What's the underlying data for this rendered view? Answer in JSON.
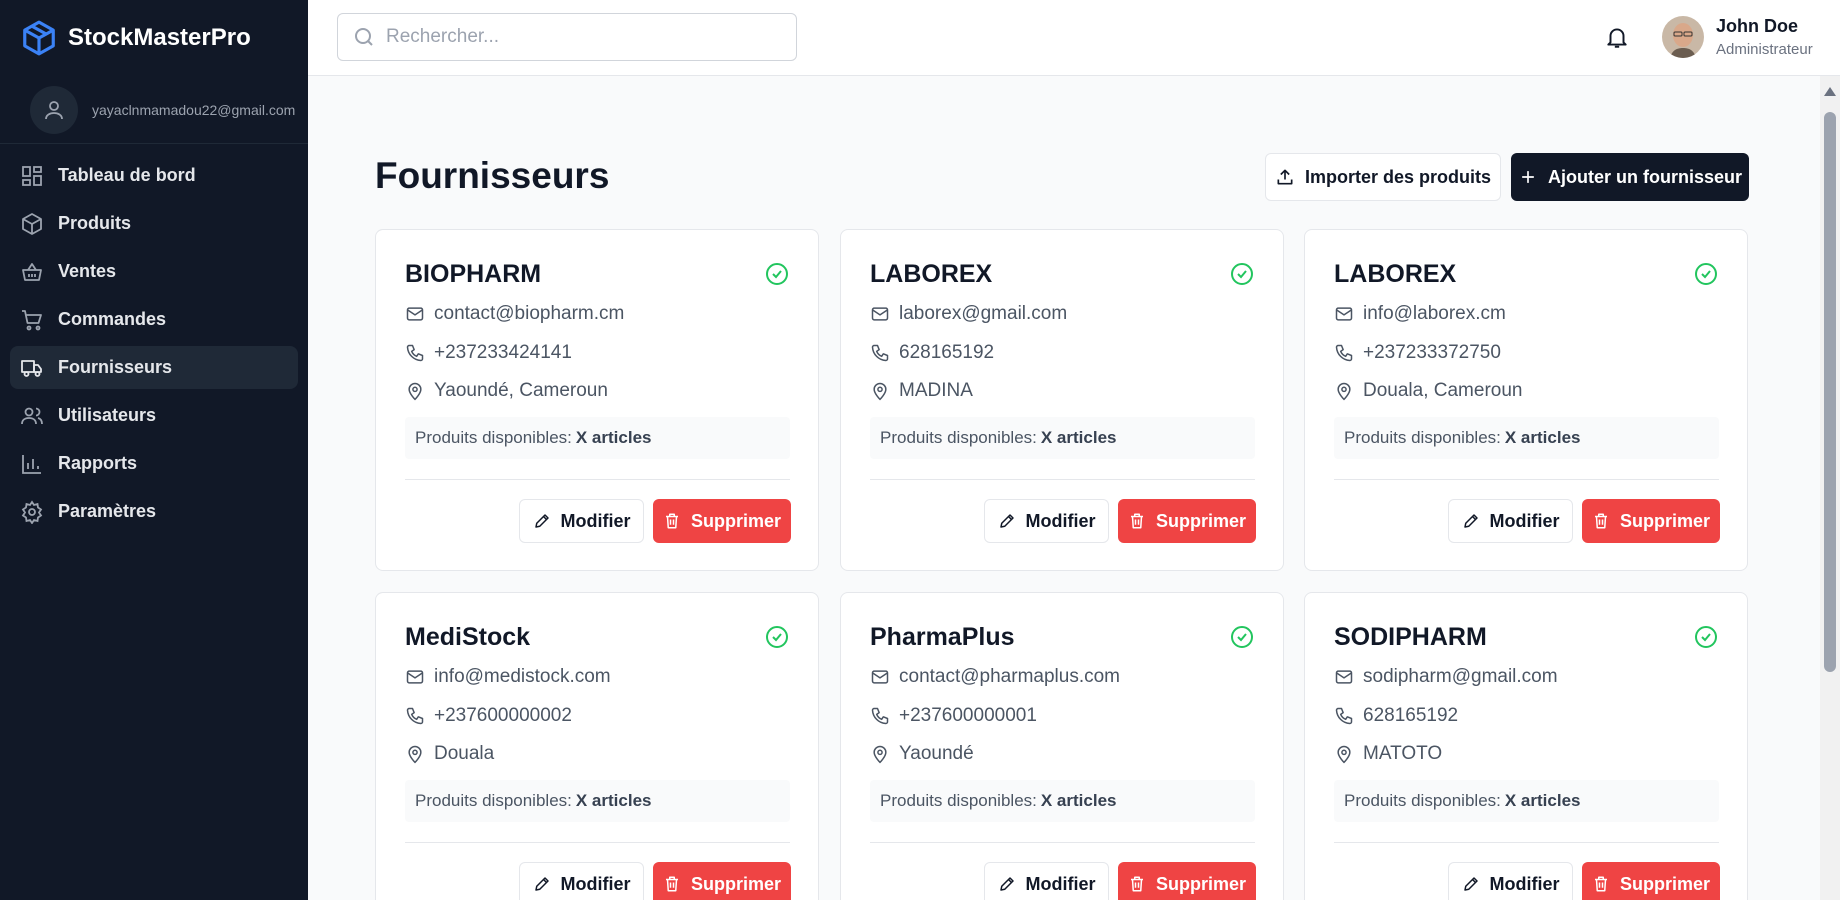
{
  "app": {
    "title": "StockMasterPro"
  },
  "sidebar": {
    "user_email": "yayaclnmamadou22@gmail.com",
    "items": [
      {
        "label": "Tableau de bord",
        "icon": "dashboard-icon"
      },
      {
        "label": "Produits",
        "icon": "box-icon"
      },
      {
        "label": "Ventes",
        "icon": "basket-icon"
      },
      {
        "label": "Commandes",
        "icon": "cart-icon"
      },
      {
        "label": "Fournisseurs",
        "icon": "truck-icon",
        "active": true
      },
      {
        "label": "Utilisateurs",
        "icon": "users-icon"
      },
      {
        "label": "Rapports",
        "icon": "bar-chart-icon"
      },
      {
        "label": "Paramètres",
        "icon": "gear-icon"
      }
    ]
  },
  "header": {
    "search_placeholder": "Rechercher...",
    "user_name": "John Doe",
    "user_role": "Administrateur"
  },
  "main": {
    "title": "Fournisseurs",
    "import_label": "Importer des produits",
    "add_label": "Ajouter un fournisseur",
    "stock_label": "Produits disponibles:",
    "edit_label": "Modifier",
    "delete_label": "Supprimer",
    "suppliers": [
      {
        "name": "BIOPHARM",
        "email": "contact@biopharm.cm",
        "phone": "+237233424141",
        "location": "Yaoundé, Cameroun",
        "stock": "X articles"
      },
      {
        "name": "LABOREX",
        "email": "laborex@gmail.com",
        "phone": "628165192",
        "location": "MADINA",
        "stock": "X articles"
      },
      {
        "name": "LABOREX",
        "email": "info@laborex.cm",
        "phone": "+237233372750",
        "location": "Douala, Cameroun",
        "stock": "X articles"
      },
      {
        "name": "MediStock",
        "email": "info@medistock.com",
        "phone": "+237600000002",
        "location": "Douala",
        "stock": "X articles"
      },
      {
        "name": "PharmaPlus",
        "email": "contact@pharmaplus.com",
        "phone": "+237600000001",
        "location": "Yaoundé",
        "stock": "X articles"
      },
      {
        "name": "SODIPHARM",
        "email": "sodipharm@gmail.com",
        "phone": "628165192",
        "location": "MATOTO",
        "stock": "X articles"
      }
    ]
  },
  "colors": {
    "sidebar_bg": "#111827",
    "accent_blue": "#3b82f6",
    "danger": "#ef4444",
    "success": "#22c55e"
  }
}
